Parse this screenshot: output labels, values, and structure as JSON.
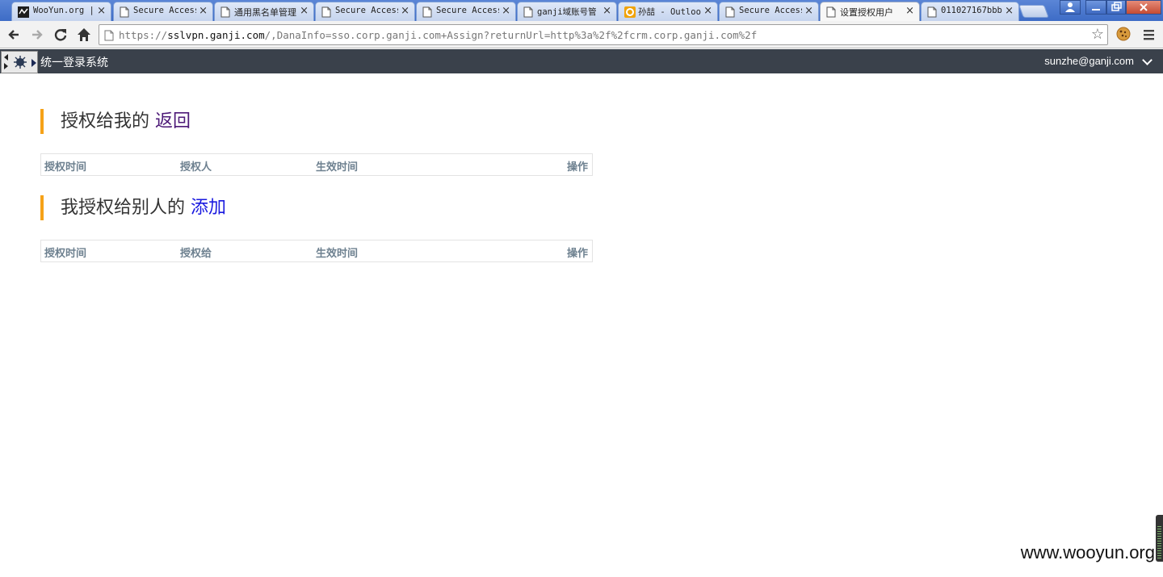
{
  "browser": {
    "tabs": [
      {
        "title": "WooYun.org | ",
        "favicon": "wooyun-icon",
        "active": false
      },
      {
        "title": "Secure Access",
        "favicon": "page-icon",
        "active": false
      },
      {
        "title": "通用黑名单管理",
        "favicon": "page-icon",
        "active": false
      },
      {
        "title": "Secure Access",
        "favicon": "page-icon",
        "active": false
      },
      {
        "title": "Secure Access",
        "favicon": "page-icon",
        "active": false
      },
      {
        "title": "ganji域账号管",
        "favicon": "page-icon",
        "active": false
      },
      {
        "title": "孙喆 - Outlook",
        "favicon": "outlook-icon",
        "active": false
      },
      {
        "title": "Secure Access",
        "favicon": "page-icon",
        "active": false
      },
      {
        "title": "设置授权用户",
        "favicon": "page-icon",
        "active": true
      },
      {
        "title": "011027167bbb",
        "favicon": "page-icon",
        "active": false
      }
    ],
    "tab_close_glyph": "×",
    "address": {
      "scheme": "https://",
      "host": "sslvpn.ganji.com",
      "rest": "/,DanaInfo=sso.corp.ganji.com+Assign?returnUrl=http%3a%2f%2fcrm.corp.ganji.com%2f"
    }
  },
  "header": {
    "app_title": "统一登录系统",
    "user_email": "sunzhe@ganji.com"
  },
  "section1": {
    "title": "授权给我的",
    "link": "返回",
    "columns": [
      "授权时间",
      "授权人",
      "生效时间",
      "操作"
    ]
  },
  "section2": {
    "title": "我授权给别人的",
    "link": "添加",
    "columns": [
      "授权时间",
      "授权给",
      "生效时间",
      "操作"
    ]
  },
  "watermark": "www.wooyun.org",
  "colors": {
    "accent_bar": "#f5a218",
    "header_bg": "#3a414b",
    "column_header": "#6e8190",
    "visited_link": "#4d1a78",
    "link": "#1a1adf"
  }
}
